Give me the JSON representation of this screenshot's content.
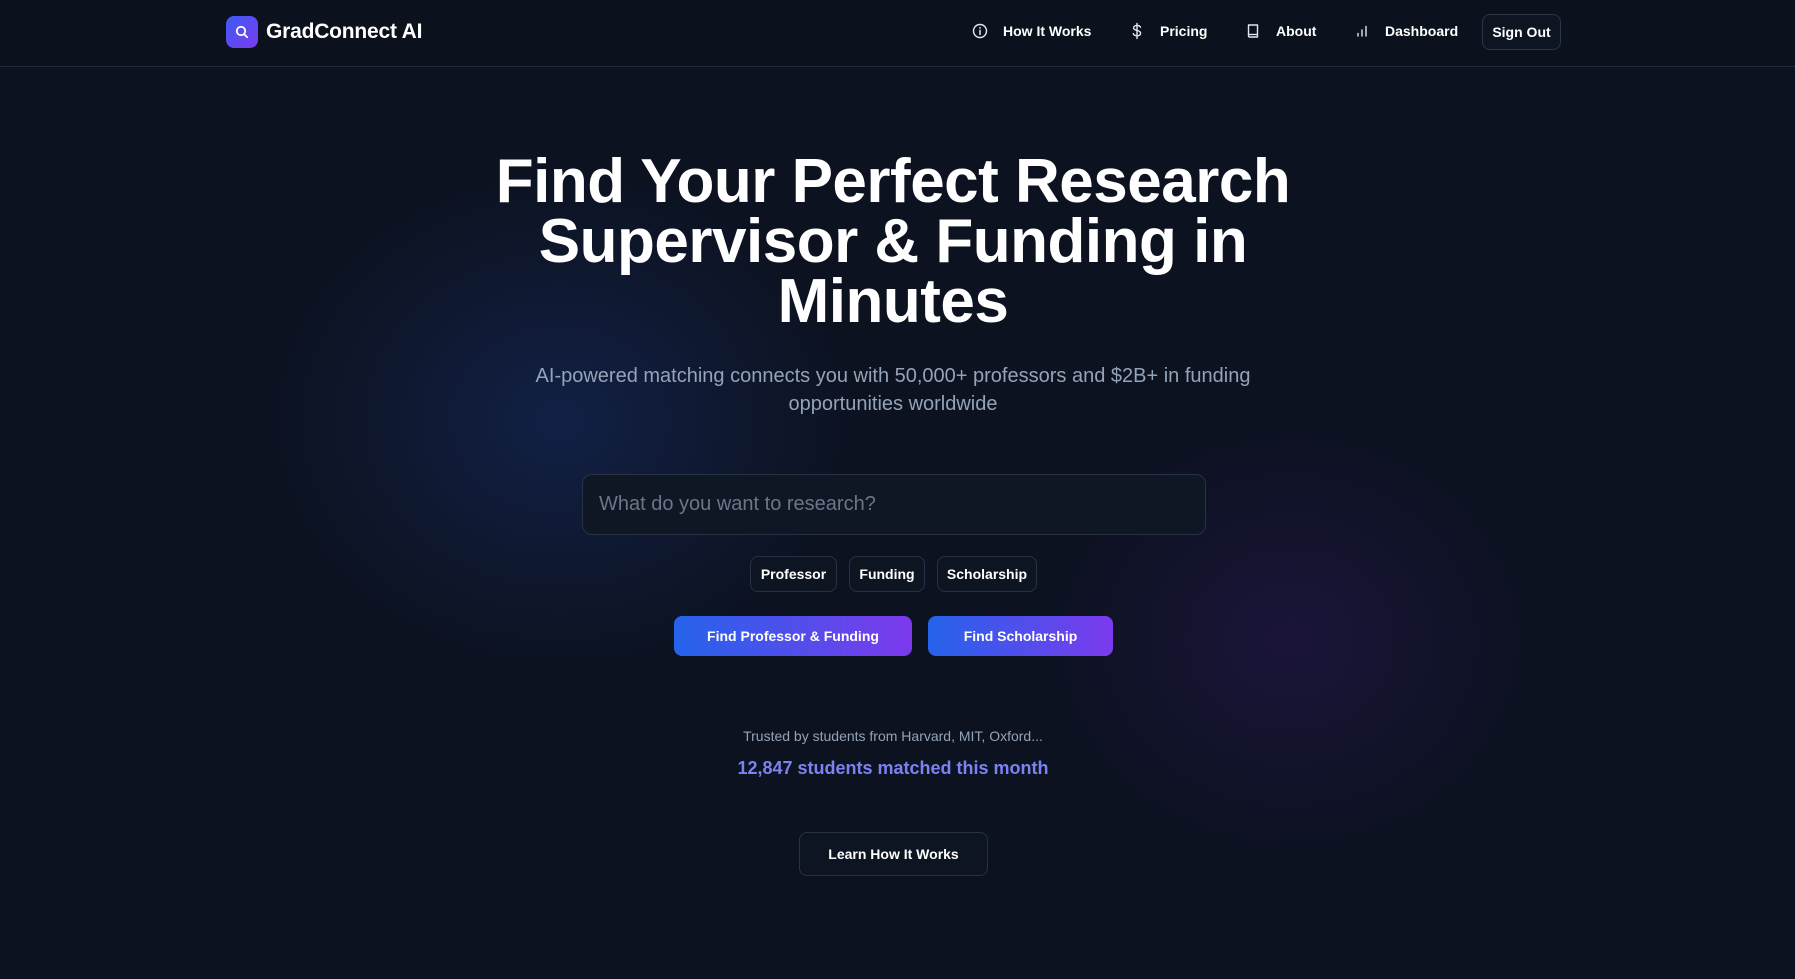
{
  "brand": {
    "name": "GradConnect AI",
    "logo_icon": "search-icon"
  },
  "nav": {
    "items": [
      {
        "label": "How It Works",
        "icon": "info-circle-icon"
      },
      {
        "label": "Pricing",
        "icon": "dollar-icon"
      },
      {
        "label": "About",
        "icon": "book-icon"
      },
      {
        "label": "Dashboard",
        "icon": "bar-chart-icon"
      }
    ],
    "sign_out_label": "Sign Out"
  },
  "hero": {
    "title": "Find Your Perfect Research Supervisor & Funding in Minutes",
    "subtitle": "AI-powered matching connects you with 50,000+ professors and $2B+ in funding opportunities worldwide"
  },
  "search": {
    "placeholder": "What do you want to research?",
    "value": ""
  },
  "filters": [
    {
      "label": "Professor"
    },
    {
      "label": "Funding"
    },
    {
      "label": "Scholarship"
    }
  ],
  "actions": {
    "find_professor_funding": "Find Professor & Funding",
    "find_scholarship": "Find Scholarship"
  },
  "social_proof": {
    "trusted_text": "Trusted by students from Harvard, MIT, Oxford...",
    "matched_text": "12,847 students matched this month"
  },
  "learn_button_label": "Learn How It Works",
  "colors": {
    "background": "#0c1220",
    "accent_start": "#2563eb",
    "accent_end": "#7c3aed",
    "highlight_text": "#7c83f0"
  }
}
